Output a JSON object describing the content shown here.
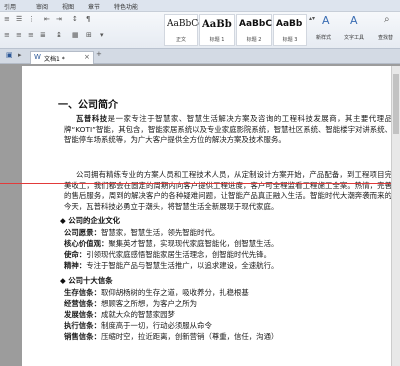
{
  "menu": [
    "引用",
    "审阅",
    "视图",
    "章节",
    "特色功能"
  ],
  "styles": [
    {
      "sample": "AaBbCcI",
      "label": "正文"
    },
    {
      "sample": "AaBb",
      "label": "标题 1"
    },
    {
      "sample": "AaBbC",
      "label": "标题 2"
    },
    {
      "sample": "AaBb",
      "label": "标题 3"
    }
  ],
  "ribbon_right": {
    "new_style": "新样式",
    "text_tools": "文字工具",
    "find": "查找替"
  },
  "doc_tab": "文档1 *",
  "document": {
    "heading": "一、公司简介",
    "p1_company": "瓦普科技",
    "p1": "是一家专注于智慧家、智慧生活解决方案及咨询的工程科技发展商，其主要代理品牌“KOTI”智能，其包含，智能家居系统以及专业家庭影院系统，智慧社区系统、智能楼宇对讲系统、智能停车场系统等，为广大客户提供全方位的解决方案及技术服务。",
    "p2": "公司拥有精练专业的方案人员和工程技术人员，从定制设计方案开始，产品配备，到工程项目完美收工，我们都会在固定的周期内向客户提供工程进度，客户可全程监看工程施工全案。热情，完善的售后服务，周到的解决客户的各种疑难问题，让智能产品真正融入生活。智能时代大潮奔袭而来的今天，瓦普科技必勇立于潮头，将智慧生活全新展现于现代家庭。",
    "culture_title": "◆ 公司的企业文化",
    "culture": [
      {
        "k": "公司愿景：",
        "v": "智慧家，智慧生活，领先智能时代。"
      },
      {
        "k": "核心价值观：",
        "v": "聚集英才智慧，实现现代家庭智能化，创智慧生活。"
      },
      {
        "k": "使命：",
        "v": "引领现代家庭感悟智能家居生活理念，创智能时代先锋。"
      },
      {
        "k": "精神：",
        "v": "专注于智能产品与智慧生活推广，以追求建设，全速航行。"
      }
    ],
    "ten_title": "◆ 公司十大信条",
    "tenets": [
      {
        "k": "生存信条：",
        "v": "取仰胡杨树的生存之道，吸收养分，扎稳根基"
      },
      {
        "k": "经营信条：",
        "v": "想顾客之所想，为客户之所为"
      },
      {
        "k": "发展信条：",
        "v": "成就大众的智慧家园梦"
      },
      {
        "k": "执行信条：",
        "v": "制度高于一切，行动必须服从命令"
      },
      {
        "k": "销售信条：",
        "v": "压缩时空，拉近距离，创新营销（尊重，信任，沟通）"
      }
    ]
  }
}
